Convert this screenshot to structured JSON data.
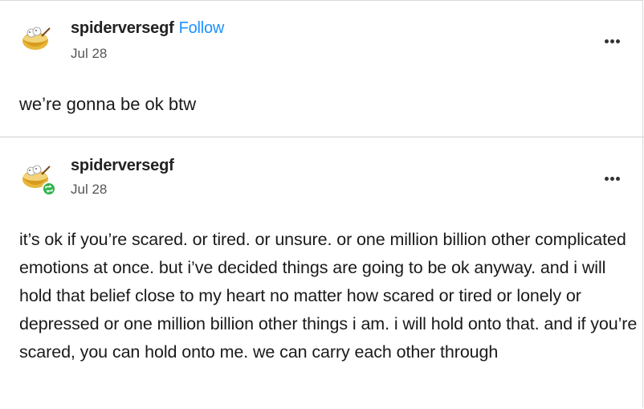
{
  "posts": [
    {
      "username": "spiderversegf",
      "follow_label": "Follow",
      "date": "Jul 28",
      "body": "we’re gonna be ok btw"
    },
    {
      "username": "spiderversegf",
      "date": "Jul 28",
      "body": "it’s ok if you’re scared. or tired. or unsure. or one million billion other complicated emotions at once. but i’ve decided things are going to be ok anyway. and i will hold that belief close to my heart no matter how scared or tired or lonely or depressed or one million billion other things i am. i will hold onto that. and if you’re scared, you can hold onto me. we can carry each other through"
    }
  ],
  "colors": {
    "follow_link": "#1e90ff",
    "reblog_badge": "#2fb34a",
    "divider": "#cfcfcf"
  },
  "icons": {
    "avatar": "bowl-avatar-icon",
    "menu": "more-options-icon",
    "reblog": "reblog-icon"
  }
}
